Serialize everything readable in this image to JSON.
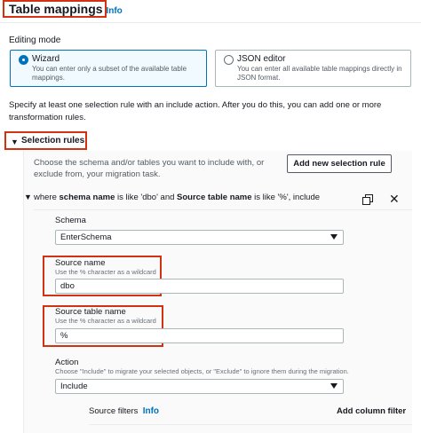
{
  "header": {
    "title": "Table mappings",
    "info": "Info"
  },
  "editing_mode": {
    "label": "Editing mode",
    "options": [
      {
        "title": "Wizard",
        "description": "You can enter only a subset of the available table mappings.",
        "selected": true
      },
      {
        "title": "JSON editor",
        "description": "You can enter all available table mappings directly in JSON format.",
        "selected": false
      }
    ]
  },
  "instructions": "Specify at least one selection rule with an include action. After you do this, you can add one or more transformation rules.",
  "selection_rules": {
    "title": "Selection rules",
    "description": "Choose the schema and/or tables you want to include with, or exclude from, your migration task.",
    "add_button": "Add new selection rule",
    "rule": {
      "summary_prefix": "where",
      "schema_name_label": "schema name",
      "is_like": "is like",
      "schema_value": "'dbo'",
      "and": "and",
      "source_table_label": "Source table name",
      "table_value": "'%'",
      "suffix": ", include",
      "schema": {
        "label": "Schema",
        "value": "EnterSchema"
      },
      "source_name": {
        "label": "Source name",
        "hint": "Use the % character as a wildcard",
        "value": "dbo"
      },
      "source_table_name": {
        "label": "Source table name",
        "hint": "Use the % character as a wildcard",
        "value": "%"
      },
      "action": {
        "label": "Action",
        "hint": "Choose \"Include\" to migrate your selected objects, or \"Exclude\" to ignore them during the migration.",
        "value": "Include"
      },
      "source_filters": {
        "label": "Source filters",
        "info": "Info",
        "add_label": "Add column filter"
      }
    }
  },
  "colors": {
    "accent": "#0073bb",
    "highlight_box": "#d13212",
    "text": "#16191f"
  }
}
